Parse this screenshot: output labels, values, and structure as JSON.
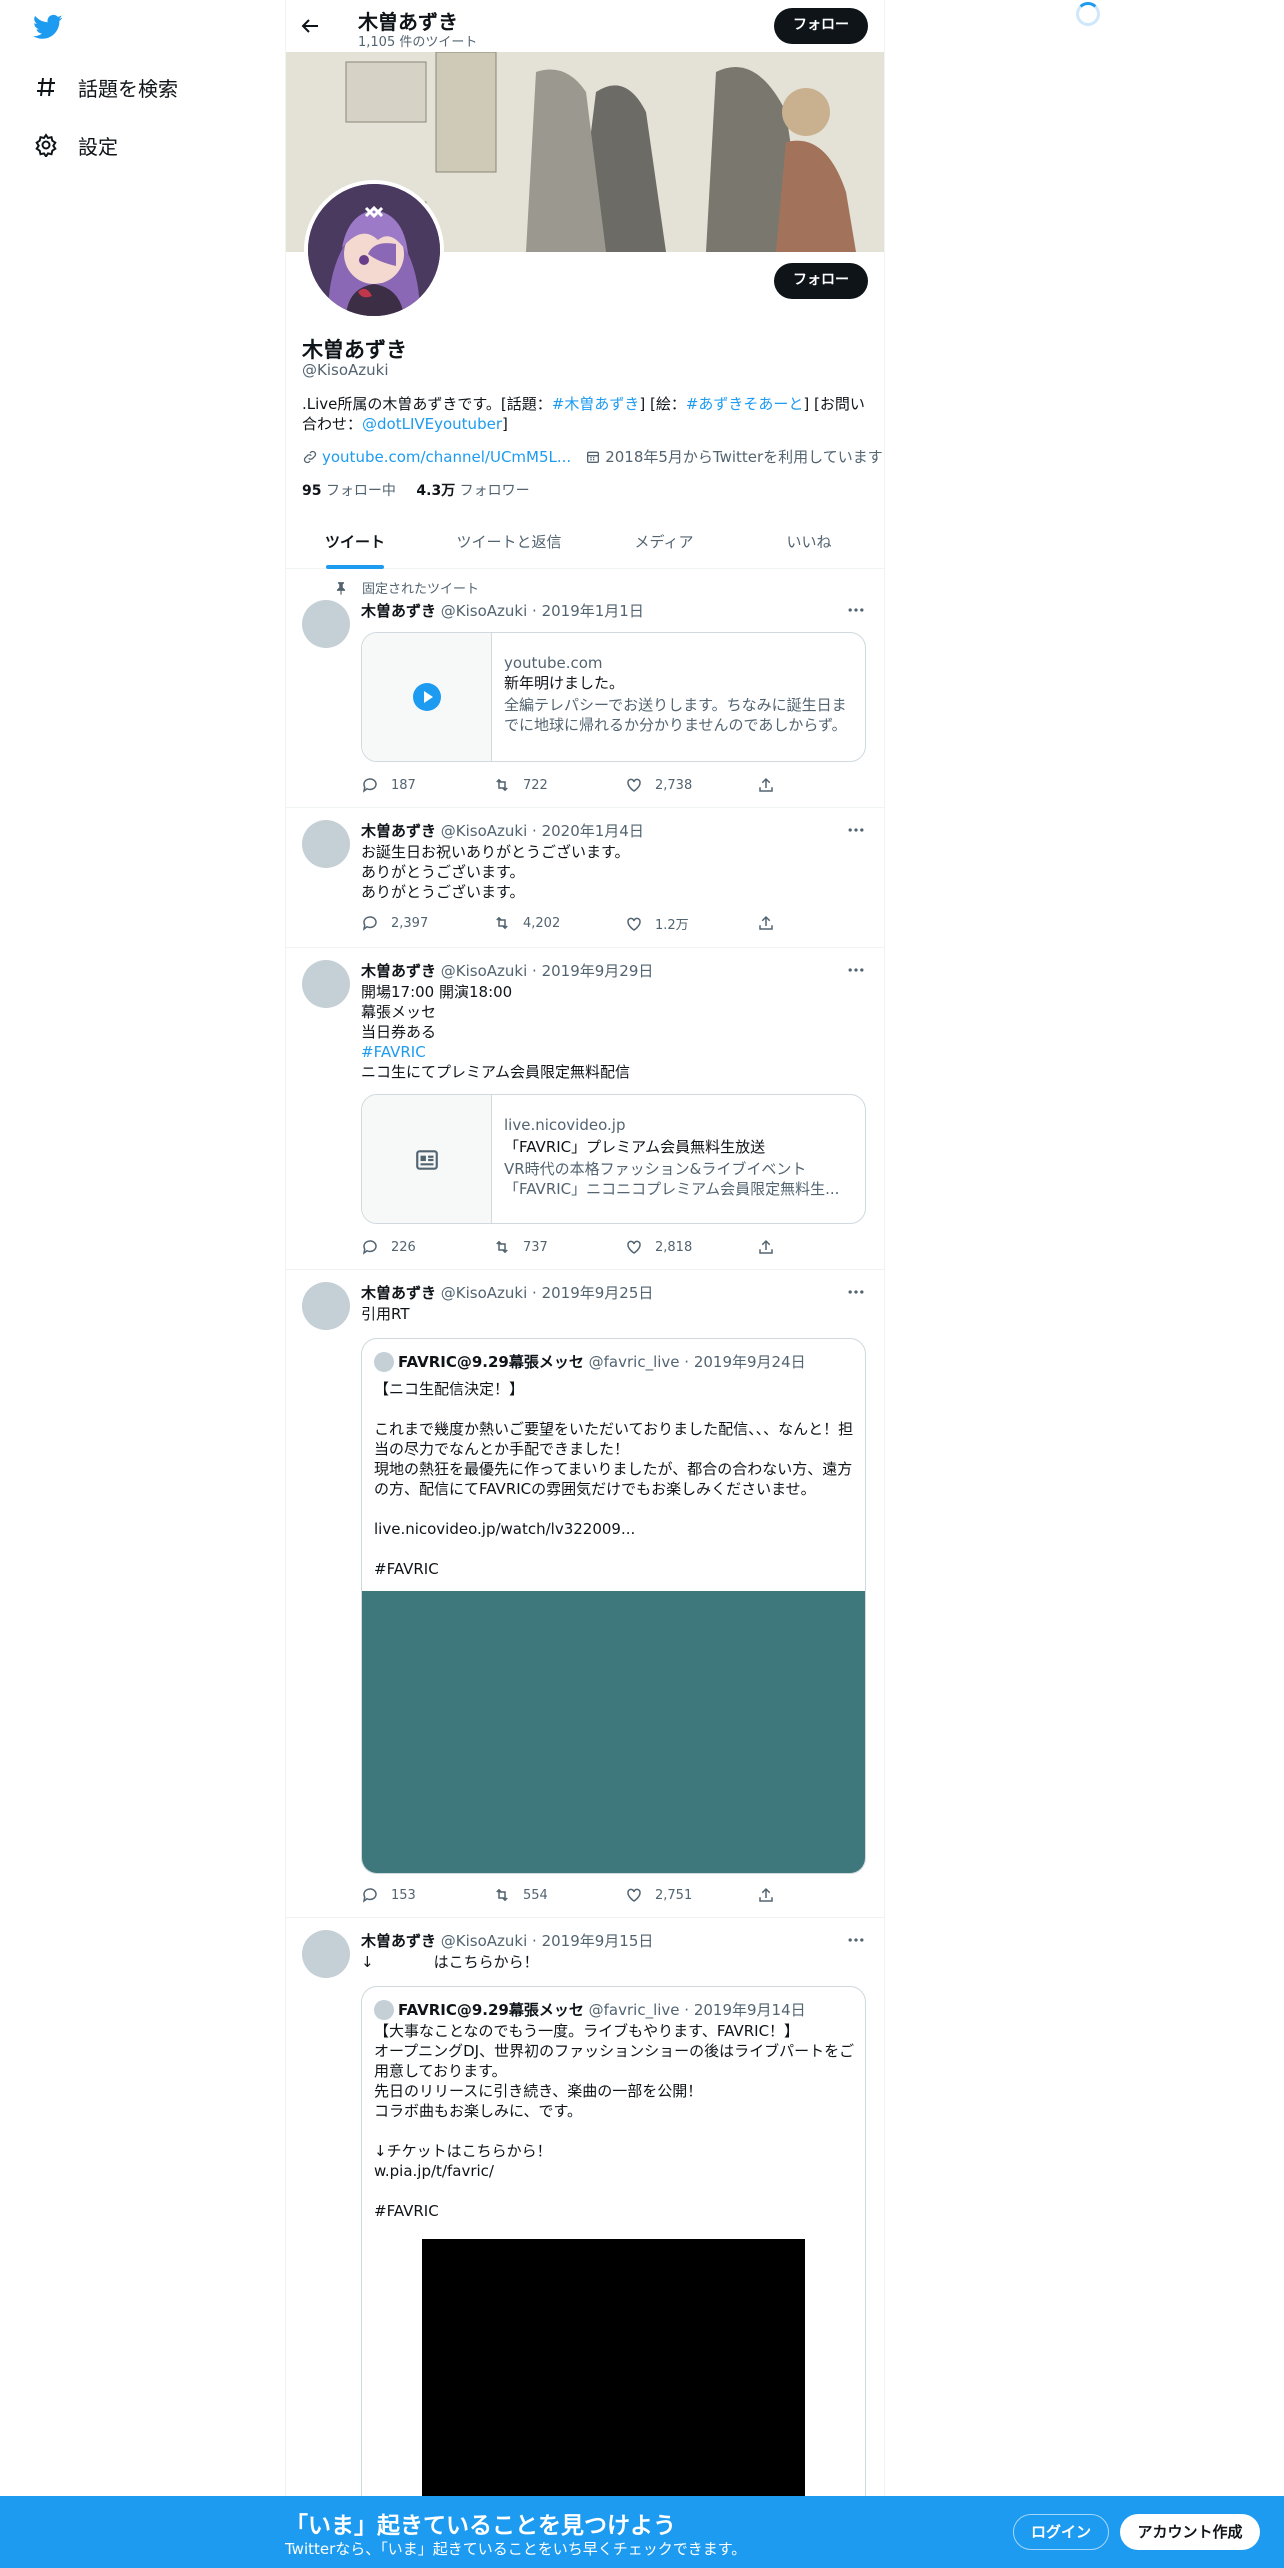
{
  "nav": {
    "explore": "話題を検索",
    "settings": "設定"
  },
  "header": {
    "name": "木曽あずき",
    "tweet_count": "1,105 件のツイート",
    "follow": "フォロー"
  },
  "profile": {
    "follow": "フォロー",
    "name": "木曽あずき",
    "handle": "@KisoAzuki",
    "bio_1": ".Live所属の木曽あずきです。[話題：",
    "bio_tag1": "#木曽あずき",
    "bio_2": "] [絵：",
    "bio_tag2": "#あずきそあーと",
    "bio_3": "] [お問い合わせ：",
    "bio_mention": "@dotLIVEyoutuber",
    "bio_4": "]",
    "url": "youtube.com/channel/UCmM5L...",
    "joined": "2018年5月からTwitterを利用しています",
    "following_count": "95",
    "following_label": "フォロー中",
    "followers_count": "4.3万",
    "followers_label": "フォロワー"
  },
  "tabs": [
    "ツイート",
    "ツイートと返信",
    "メディア",
    "いいね"
  ],
  "tweets": [
    {
      "pinned": "固定されたツイート",
      "name": "木曽あずき",
      "meta": "@KisoAzuki · 2019年1月1日",
      "card_domain": "youtube.com",
      "card_title": "新年明けました。",
      "card_desc": "全編テレパシーでお送りします。ちなみに誕生日までに地球に帰れるか分かりませんのであしからず。",
      "reply": "187",
      "retweet": "722",
      "like": "2,738"
    },
    {
      "name": "木曽あずき",
      "meta": "@KisoAzuki · 2020年1月4日",
      "text": "お誕生日お祝いありがとうございます。\nありがとうございます。\nありがとうございます。",
      "reply": "2,397",
      "retweet": "4,202",
      "like": "1.2万"
    },
    {
      "name": "木曽あずき",
      "meta": "@KisoAzuki · 2019年9月29日",
      "text": "開場17:00 開演18:00\n幕張メッセ\n当日券ある",
      "tag": "#FAVRIC",
      "text2": "ニコ生にてプレミアム会員限定無料配信",
      "card_domain": "live.nicovideo.jp",
      "card_title": "「FAVRIC」プレミアム会員無料生放送",
      "card_desc": "VR時代の本格ファッション&ライブイベント「FAVRIC」ニコニコプレミアム会員限定無料生...",
      "reply": "226",
      "retweet": "737",
      "like": "2,818"
    },
    {
      "name": "木曽あずき",
      "meta": "@KisoAzuki · 2019年9月25日",
      "text": "引用RT",
      "q_name": "FAVRIC@9.29幕張メッセ",
      "q_meta": "@favric_live · 2019年9月24日",
      "q_text": "【ニコ生配信決定！】\n\nこれまで幾度か熱いご要望をいただいておりました配信、、、なんと！担当の尽力でなんとか手配できました！\n現地の熱狂を最優先に作ってまいりましたが、都合の合わない方、遠方の方、配信にてFAVRICの雰囲気だけでもお楽しみくださいませ。\n\nlive.nicovideo.jp/watch/lv322009...\n\n#FAVRIC",
      "reply": "153",
      "retweet": "554",
      "like": "2,751"
    },
    {
      "name": "木曽あずき",
      "meta": "@KisoAzuki · 2019年9月15日",
      "text": "↓　　　　はこちらから！",
      "q_name": "FAVRIC@9.29幕張メッセ",
      "q_meta": "@favric_live · 2019年9月14日",
      "q_text": "【大事なことなのでもう一度。ライブもやります、FAVRIC！】\nオープニングDJ、世界初のファッションショーの後はライブパートをご用意しております。\n先日のリリースに引き続き、楽曲の一部を公開！\nコラボ曲もお楽しみに、です。\n\n↓チケットはこちらから！\nw.pia.jp/t/favric/\n\n#FAVRIC"
    }
  ],
  "bottom": {
    "title": "「いま」起きていることを見つけよう",
    "subtitle": "Twitterなら、「いま」起きていることをいち早くチェックできます。",
    "login": "ログイン",
    "signup": "アカウント作成"
  },
  "colors": {
    "accent": "#1d9bf0",
    "quote_media": "#3e777c"
  }
}
